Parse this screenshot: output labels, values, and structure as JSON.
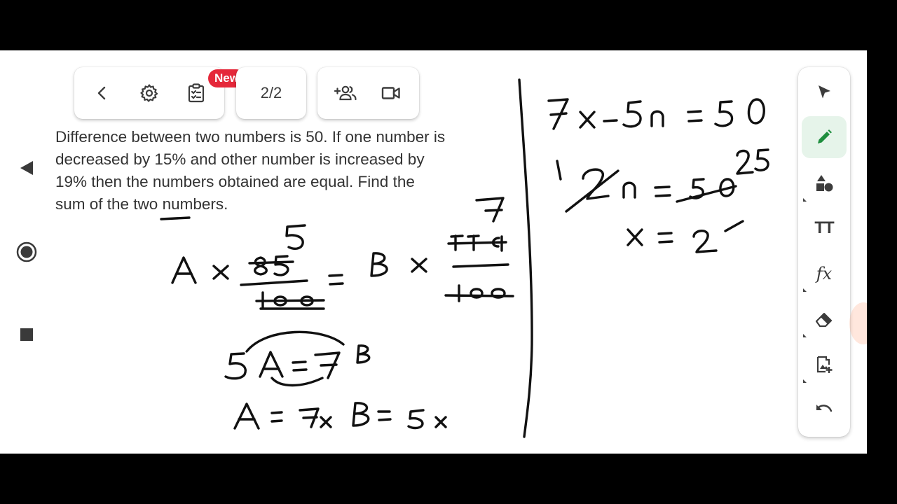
{
  "toolbar": {
    "back_icon": "chevron-left-icon",
    "settings_icon": "gear-icon",
    "clipboard_icon": "clipboard-list-icon",
    "new_badge": "New",
    "page_indicator": "2/2",
    "participants_icon": "people-add-icon",
    "video_icon": "video-camera-icon"
  },
  "question": {
    "text": "Difference between two numbers is 50. If one number is decreased by 15% and other number is increased by 19% then the numbers obtained are equal. Find the sum of the two numbers."
  },
  "android_nav": {
    "back": "triangle-back-icon",
    "home": "circle-home-icon",
    "recents": "square-recents-icon"
  },
  "tools": [
    {
      "name": "select",
      "icon": "cursor-arrow-icon"
    },
    {
      "name": "pen",
      "icon": "pen-icon",
      "active": true
    },
    {
      "name": "shapes",
      "icon": "shapes-icon"
    },
    {
      "name": "text",
      "icon": "text-size-icon",
      "label": "TT"
    },
    {
      "name": "formula",
      "icon": "function-icon",
      "label": "fx"
    },
    {
      "name": "eraser",
      "icon": "eraser-icon"
    },
    {
      "name": "add-image",
      "icon": "add-image-icon"
    },
    {
      "name": "undo",
      "icon": "undo-icon"
    }
  ],
  "colors": {
    "active_tool": "#1e8e3e",
    "active_tool_bg": "#e6f4ea",
    "badge": "#e5283a",
    "ink": "#111111"
  },
  "handwriting_lines": [
    "A × 85/100 = B × 119/100",
    "5A = 7B",
    "A = 7x B = 5x",
    "7x − 5x = 50",
    "2x = 50",
    "x = 25"
  ]
}
